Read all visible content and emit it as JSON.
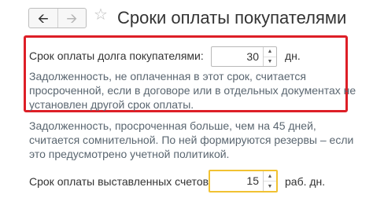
{
  "nav": {
    "back_icon": "arrow-left-icon",
    "forward_icon": "arrow-right-icon",
    "favorite_icon": "star-icon"
  },
  "window": {
    "title": "Сроки оплаты покупателями"
  },
  "debt_term": {
    "label": "Срок оплаты долга покупателями:",
    "value": "30",
    "unit": "дн.",
    "note_lines": [
      "Задолженность, не оплаченная в этот срок, считается",
      "просроченной, если в договоре или в отдельных документах не",
      "установлен другой срок оплаты."
    ]
  },
  "doubtful_note_lines": [
    "Задолженность, просроченная больше, чем на 45 дней,",
    "считается сомнительной. По ней формируются резервы – если",
    "это предусмотрено учетной политикой."
  ],
  "invoice_term": {
    "label": "Срок оплаты выставленных счетов:",
    "value": "15",
    "unit": "раб. дн."
  },
  "colors": {
    "highlight_border": "#dd1f27",
    "active_field_border": "#f1c232",
    "note_text": "#5a6670"
  }
}
